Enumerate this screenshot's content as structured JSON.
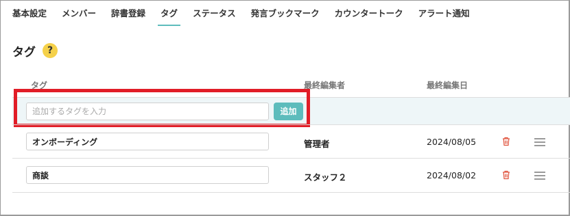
{
  "tabs": [
    "基本設定",
    "メンバー",
    "辞書登録",
    "タグ",
    "ステータス",
    "発言ブックマーク",
    "カウンタートーク",
    "アラート通知"
  ],
  "active_tab": "タグ",
  "page_title": "タグ",
  "help_label": "?",
  "columns": {
    "tag": "タグ",
    "editor": "最終編集者",
    "date": "最終編集日"
  },
  "add_row": {
    "placeholder": "追加するタグを入力",
    "button_label": "追加"
  },
  "rows": [
    {
      "tag": "オンボーディング",
      "editor": "管理者",
      "date": "2024/08/05"
    },
    {
      "tag": "商談",
      "editor": "スタッフ２",
      "date": "2024/08/02"
    }
  ],
  "colors": {
    "accent": "#5dbcbc",
    "highlight": "#e11d27",
    "help": "#f5d14a",
    "delete": "#e0533d"
  }
}
